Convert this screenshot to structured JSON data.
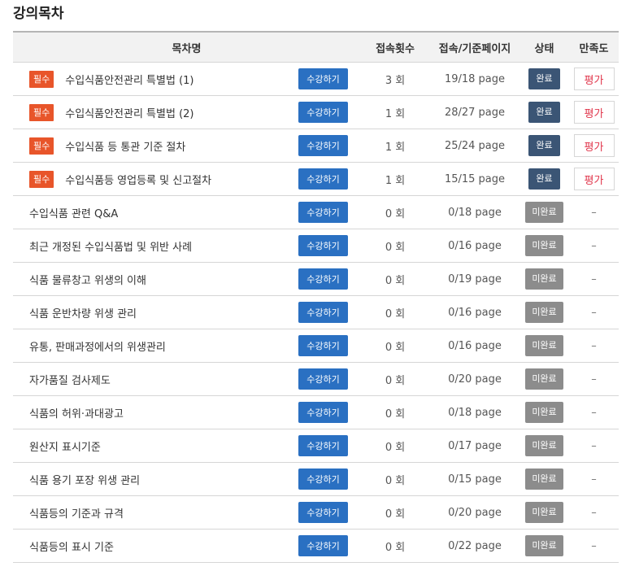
{
  "page": {
    "title": "강의목차"
  },
  "table": {
    "headers": {
      "title": "목차명",
      "count": "접속횟수",
      "pages": "접속/기준페이지",
      "status": "상태",
      "satisfaction": "만족도"
    },
    "study_label": "수강하기",
    "required_label": "필수",
    "rows": [
      {
        "required": true,
        "title": "수입식품안전관리 특별법 (1)",
        "count": "3 회",
        "pages": "19/18 page",
        "status": "완료",
        "satisfaction": "평가"
      },
      {
        "required": true,
        "title": "수입식품안전관리 특별법 (2)",
        "count": "1 회",
        "pages": "28/27 page",
        "status": "완료",
        "satisfaction": "평가"
      },
      {
        "required": true,
        "title": "수입식품 등 통관 기준 절차",
        "count": "1 회",
        "pages": "25/24 page",
        "status": "완료",
        "satisfaction": "평가"
      },
      {
        "required": true,
        "title": "수입식품등 영업등록 및 신고절차",
        "count": "1 회",
        "pages": "15/15 page",
        "status": "완료",
        "satisfaction": "평가"
      },
      {
        "required": false,
        "title": "수입식품 관련 Q&A",
        "count": "0 회",
        "pages": "0/18 page",
        "status": "미완료",
        "satisfaction": "–"
      },
      {
        "required": false,
        "title": "최근 개정된 수입식품법 및 위반 사례",
        "count": "0 회",
        "pages": "0/16 page",
        "status": "미완료",
        "satisfaction": "–"
      },
      {
        "required": false,
        "title": "식품 물류창고 위생의 이해",
        "count": "0 회",
        "pages": "0/19 page",
        "status": "미완료",
        "satisfaction": "–"
      },
      {
        "required": false,
        "title": "식품 운반차량 위생 관리",
        "count": "0 회",
        "pages": "0/16 page",
        "status": "미완료",
        "satisfaction": "–"
      },
      {
        "required": false,
        "title": "유통, 판매과정에서의 위생관리",
        "count": "0 회",
        "pages": "0/16 page",
        "status": "미완료",
        "satisfaction": "–"
      },
      {
        "required": false,
        "title": "자가품질 검사제도",
        "count": "0 회",
        "pages": "0/20 page",
        "status": "미완료",
        "satisfaction": "–"
      },
      {
        "required": false,
        "title": "식품의 허위·과대광고",
        "count": "0 회",
        "pages": "0/18 page",
        "status": "미완료",
        "satisfaction": "–"
      },
      {
        "required": false,
        "title": "원산지 표시기준",
        "count": "0 회",
        "pages": "0/17 page",
        "status": "미완료",
        "satisfaction": "–"
      },
      {
        "required": false,
        "title": "식품 용기 포장 위생 관리",
        "count": "0 회",
        "pages": "0/15 page",
        "status": "미완료",
        "satisfaction": "–"
      },
      {
        "required": false,
        "title": "식품등의 기준과 규격",
        "count": "0 회",
        "pages": "0/20 page",
        "status": "미완료",
        "satisfaction": "–"
      },
      {
        "required": false,
        "title": "식품등의 표시 기준",
        "count": "0 회",
        "pages": "0/22 page",
        "status": "미완료",
        "satisfaction": "–"
      }
    ]
  },
  "colors": {
    "required_badge": "#e8552a",
    "study_button": "#2a70c2",
    "status_done": "#3b5575",
    "status_notdone": "#8c8c8c",
    "rate_text": "#e0344a"
  }
}
